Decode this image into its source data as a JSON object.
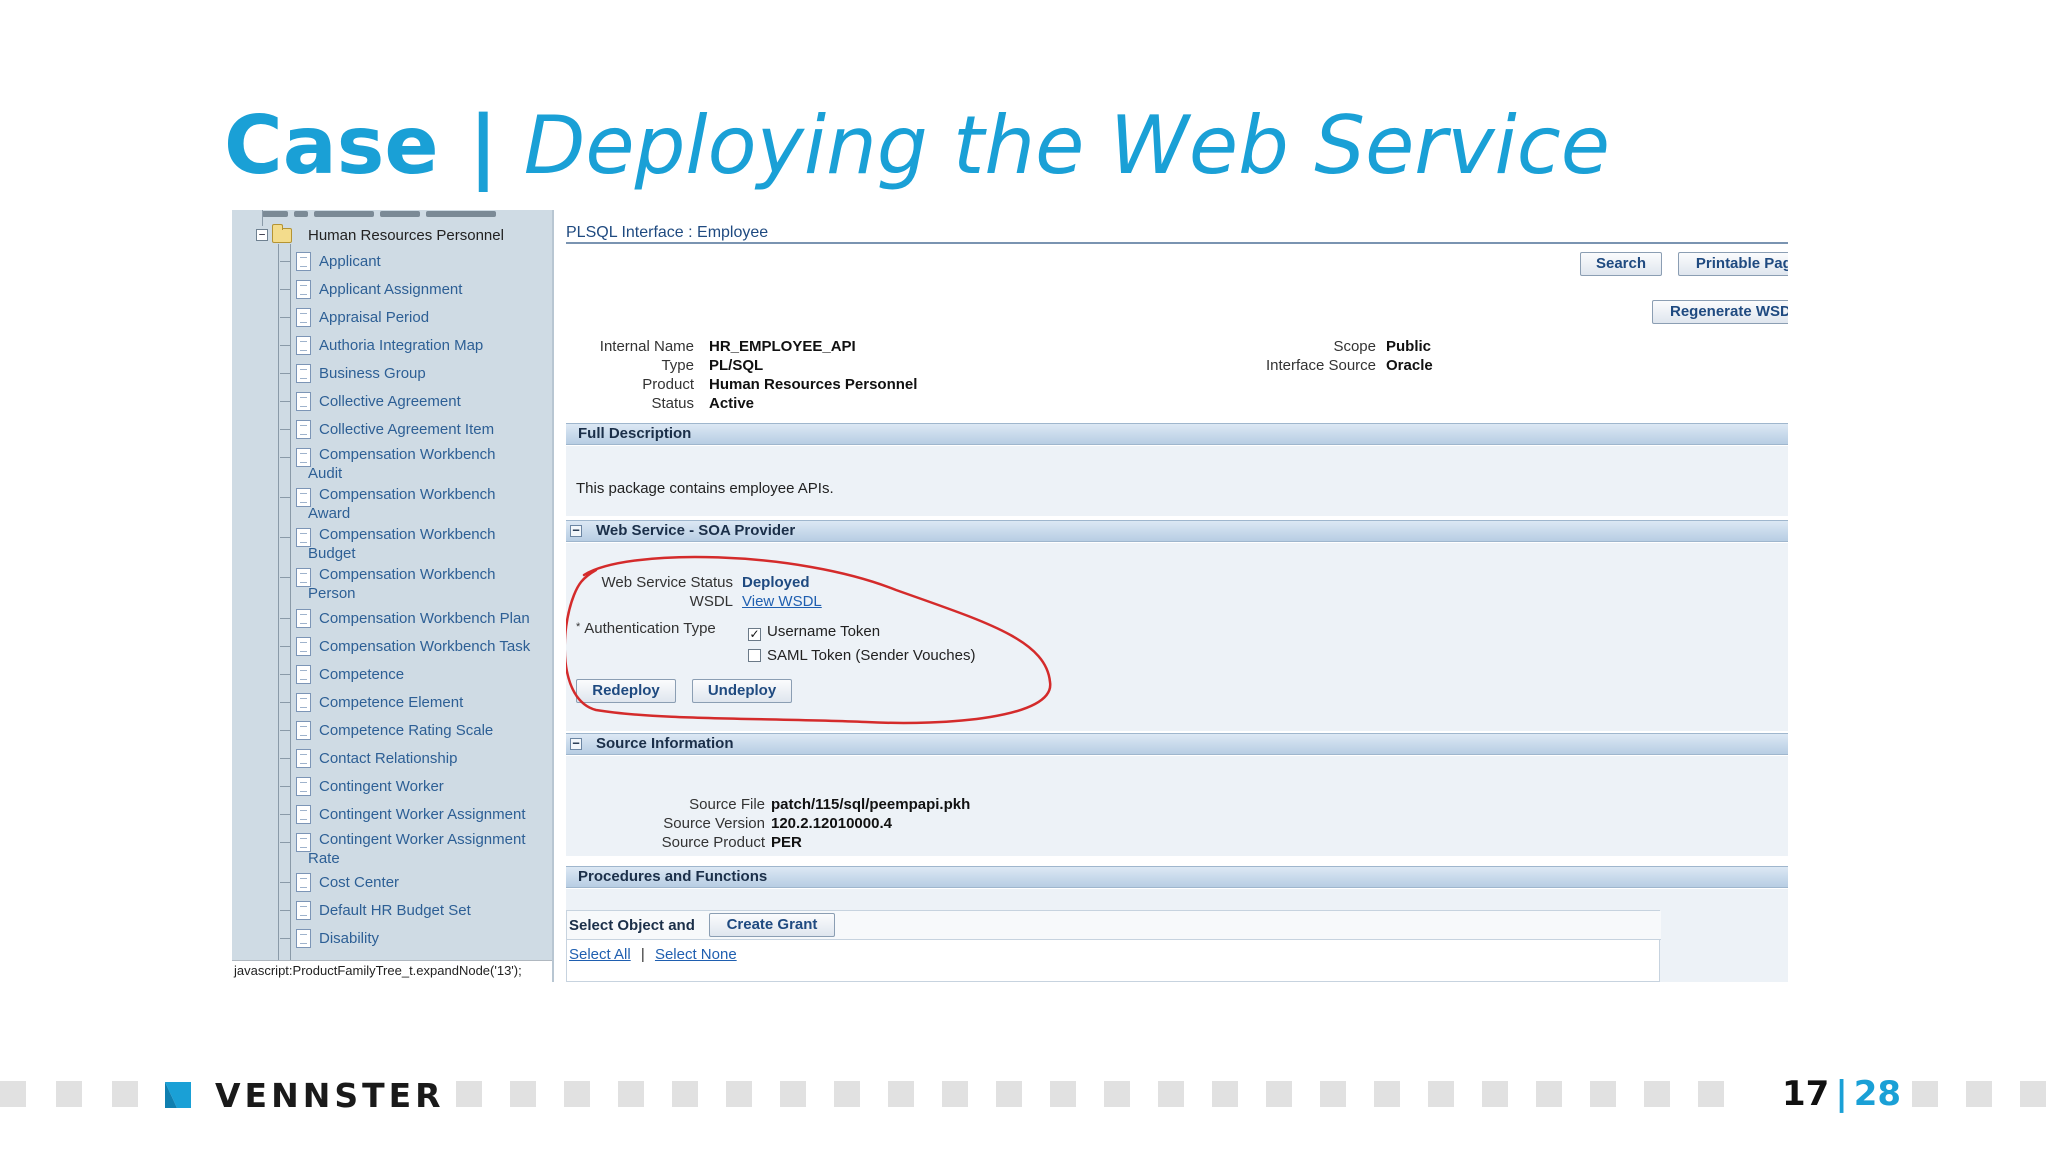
{
  "slide": {
    "title_case": "Case",
    "title_separator": "|",
    "title_rest": "Deploying the Web Service",
    "logo_text": "VENNSTER",
    "page_current": "17",
    "page_separator": "|",
    "page_total": "28",
    "accent_color": "#1aa0d6"
  },
  "tree": {
    "root_label": "Human Resources Personnel",
    "items": [
      "Applicant",
      "Applicant Assignment",
      "Appraisal Period",
      "Authoria Integration Map",
      "Business Group",
      "Collective Agreement",
      "Collective Agreement Item",
      "Compensation Workbench",
      "Audit",
      "Compensation Workbench",
      "Award",
      "Compensation Workbench",
      "Budget",
      "Compensation Workbench",
      "Person",
      "Compensation Workbench Plan",
      "Compensation Workbench Task",
      "Competence",
      "Competence Element",
      "Competence Rating Scale",
      "Contact Relationship",
      "Contingent Worker",
      "Contingent Worker Assignment",
      "Contingent Worker Assignment",
      "Rate",
      "Cost Center",
      "Default HR Budget Set",
      "Disability"
    ],
    "statusbar": "javascript:ProductFamilyTree_t.expandNode('13');"
  },
  "content": {
    "header": "PLSQL Interface : Employee",
    "search_button": "Search",
    "printable_button": "Printable Page",
    "regenerate_button": "Regenerate WSDL",
    "details": {
      "internal_name_label": "Internal Name",
      "internal_name": "HR_EMPLOYEE_API",
      "type_label": "Type",
      "type": "PL/SQL",
      "product_label": "Product",
      "product": "Human Resources Personnel",
      "status_label": "Status",
      "status": "Active",
      "scope_label": "Scope",
      "scope": "Public",
      "interface_source_label": "Interface Source",
      "interface_source": "Oracle"
    },
    "full_description": {
      "title": "Full Description",
      "text": "This package contains employee APIs."
    },
    "web_service": {
      "title": "Web Service - SOA Provider",
      "status_label": "Web Service Status",
      "status": "Deployed",
      "wsdl_label": "WSDL",
      "wsdl_link": "View WSDL",
      "auth_required": "*",
      "auth_label": "Authentication Type",
      "username_token": "Username Token",
      "username_token_checked": true,
      "saml_token": "SAML Token (Sender Vouches)",
      "saml_token_checked": false,
      "redeploy_button": "Redeploy",
      "undeploy_button": "Undeploy",
      "highlight_color": "#d42b2b"
    },
    "source_info": {
      "title": "Source Information",
      "file_label": "Source File",
      "file": "patch/115/sql/peempapi.pkh",
      "version_label": "Source Version",
      "version": "120.2.12010000.4",
      "product_label": "Source Product",
      "product": "PER"
    },
    "procedures": {
      "title": "Procedures and Functions",
      "select_object_label": "Select Object and",
      "create_grant_button": "Create Grant",
      "select_all": "Select All",
      "select_none": "Select None"
    }
  }
}
